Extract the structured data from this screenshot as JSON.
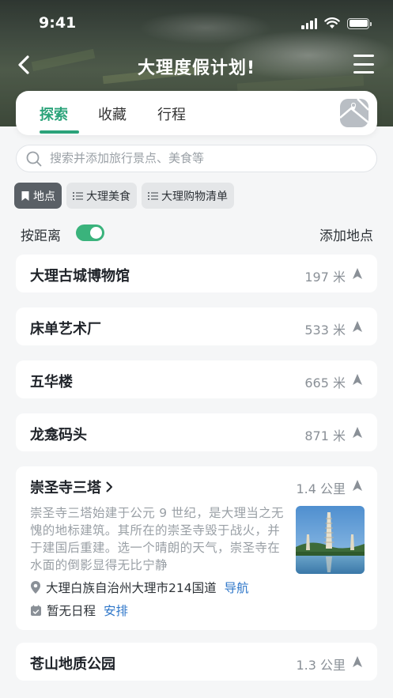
{
  "status": {
    "time": "9:41"
  },
  "nav": {
    "title": "大理度假计划!"
  },
  "tabs": [
    {
      "label": "探索",
      "active": true
    },
    {
      "label": "收藏",
      "active": false
    },
    {
      "label": "行程",
      "active": false
    }
  ],
  "search": {
    "placeholder": "搜索并添加旅行景点、美食等",
    "value": ""
  },
  "chips": [
    {
      "label": "地点",
      "icon": "bookmark-icon",
      "active": true
    },
    {
      "label": "大理美食",
      "icon": "list-icon",
      "active": false
    },
    {
      "label": "大理购物清单",
      "icon": "list-icon",
      "active": false
    }
  ],
  "sort": {
    "label": "按距离",
    "toggle_on": true,
    "add_label": "添加地点"
  },
  "places": [
    {
      "name": "大理古城博物馆",
      "distance": "197 米"
    },
    {
      "name": "床单艺术厂",
      "distance": "533 米"
    },
    {
      "name": "五华楼",
      "distance": "665 米"
    },
    {
      "name": "龙龛码头",
      "distance": "871 米"
    }
  ],
  "featured": {
    "name": "崇圣寺三塔",
    "distance": "1.4 公里",
    "description": "崇圣寺三塔始建于公元 9 世纪，是大理当之无愧的地标建筑。其所在的崇圣寺毁于战火，并于建国后重建。选一个晴朗的天气，崇圣寺在水面的倒影显得无比宁静",
    "address": "大理白族自治州大理市214国道",
    "navigate_label": "导航",
    "schedule": "暂无日程",
    "arrange_label": "安排"
  },
  "last_place": {
    "name": "苍山地质公园",
    "distance": "1.3 公里"
  },
  "colors": {
    "accent": "#2ba37a",
    "toggle": "#3ab37c",
    "link": "#2f77c9"
  }
}
